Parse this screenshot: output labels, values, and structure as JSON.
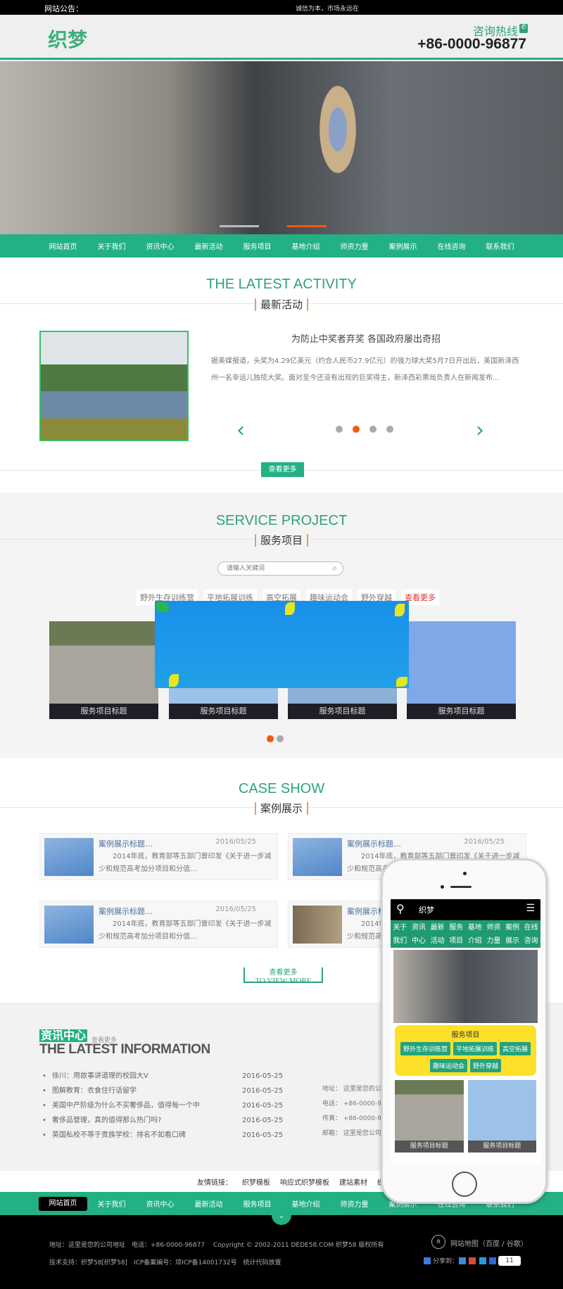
{
  "topbar": {
    "notice_label": "网站公告：",
    "notice_text": "诚信为本，市场永远在"
  },
  "header": {
    "logo": "织梦",
    "hotline_label": "咨询热线",
    "phone": "+86-0000-96877"
  },
  "nav": [
    "网站首页",
    "关于我们",
    "资讯中心",
    "最新活动",
    "服务项目",
    "基地介绍",
    "师资力量",
    "案例展示",
    "在线咨询",
    "联系我们"
  ],
  "activity": {
    "title_en": "THE LATEST ACTIVITY",
    "title_cn": "最新活动",
    "headline": "为防止中奖者弃奖 各国政府屡出奇招",
    "text": "据美媒报道，头奖为4.29亿美元（约合人民币27.9亿元）的强力球大奖5月7日开出后，美国新泽西州一名幸运儿独揽大奖。面对至今还没有出现的巨奖得主，新泽西彩票局负责人在新闻发布...",
    "more": "查看更多",
    "active_slide": 2,
    "slide_count": 4
  },
  "service": {
    "title_en": "SERVICE PROJECT",
    "title_cn": "服务项目",
    "search_placeholder": "请输入关键词",
    "tags": [
      "野外生存训练营",
      "平地拓展训练",
      "高空拓展",
      "趣味运动会",
      "野外穿越"
    ],
    "tags_more": "查看更多",
    "items": [
      "服务项目标题",
      "服务项目标题",
      "服务项目标题",
      "服务项目标题"
    ]
  },
  "cases": {
    "title_en": "CASE SHOW",
    "title_cn": "案例展示",
    "items": [
      {
        "title": "案例展示标题…",
        "date": "2016/05/25",
        "text": "2014年底，教育部等五部门曾印发《关于进一步减少和规范高考加分项目和分值..."
      },
      {
        "title": "案例展示标题…",
        "date": "2016/05/25",
        "text": "2014年底，教育部等五部门曾印发《关于进一步减少和规范高考加分项目和分值..."
      },
      {
        "title": "案例展示标题…",
        "date": "2016/05/25",
        "text": "2014年底，教育部等五部门曾印发《关于进一步减少和规范高考加分项目和分值..."
      },
      {
        "title": "案例展示标",
        "date": "",
        "text": "2014年底，教育部等五部门曾印发《关于进一步减少和规范高考加分项目和分值..."
      }
    ],
    "more_cn": "查看更多",
    "more_en": "TO VIEW MORE"
  },
  "info": {
    "title_cn": "资讯中心",
    "more": "查看更多",
    "title_en": "THE LATEST INFORMATION",
    "items": [
      {
        "title": "徐川：用故事讲道理的校园大V",
        "date": "2016-05-25"
      },
      {
        "title": "图解教育：衣食住行话留学",
        "date": "2016-05-25"
      },
      {
        "title": "美国中产阶级为什么不买奢侈品，值得每一个中",
        "date": "2016-05-25"
      },
      {
        "title": "奢侈品管理，真的值得那么热门吗?",
        "date": "2016-05-25"
      },
      {
        "title": "英国私校不等于贵族学校：排名不如看口碑",
        "date": "2016-05-25"
      }
    ],
    "contact": [
      {
        "k": "地址：",
        "v": "这里是您的公司"
      },
      {
        "k": "电话：",
        "v": "+86-0000-9687"
      },
      {
        "k": "传真：",
        "v": "+86-0000-9687"
      },
      {
        "k": "邮箱：",
        "v": "这里是您公司的"
      }
    ]
  },
  "links": {
    "label": "友情链接：",
    "items": [
      "织梦模板",
      "响应式织梦模板",
      "建站素材",
      "织梦"
    ]
  },
  "footer": {
    "line1": "地址：这里是您的公司地址　电话：+86-0000-96877　 Copyright © 2002-2011 DEDE58.COM 织梦58 版权所有",
    "line2": "技术支持：织梦58[织梦58]　ICP备案编号：琼ICP备14001732号　统计代码放置",
    "sitemap": "网站地图（百度 / 谷歌）",
    "share": "分享到：",
    "share_count": "11"
  },
  "phone": {
    "logo": "织梦",
    "nav": [
      "关于我们",
      "资讯中心",
      "最新活动",
      "服务项目",
      "基地介绍",
      "师资力量",
      "案例展示",
      "在线咨询"
    ],
    "service_title": "服务项目",
    "tags": [
      "野外生存训练营",
      "平地拓展训练",
      "高空拓展",
      "趣味运动会",
      "野外穿越"
    ],
    "items": [
      "服务项目标题",
      "服务项目标题"
    ]
  },
  "colors": {
    "accent": "#23b085",
    "active_dot": "#f05a0a",
    "phone_panel": "#fde02a"
  }
}
